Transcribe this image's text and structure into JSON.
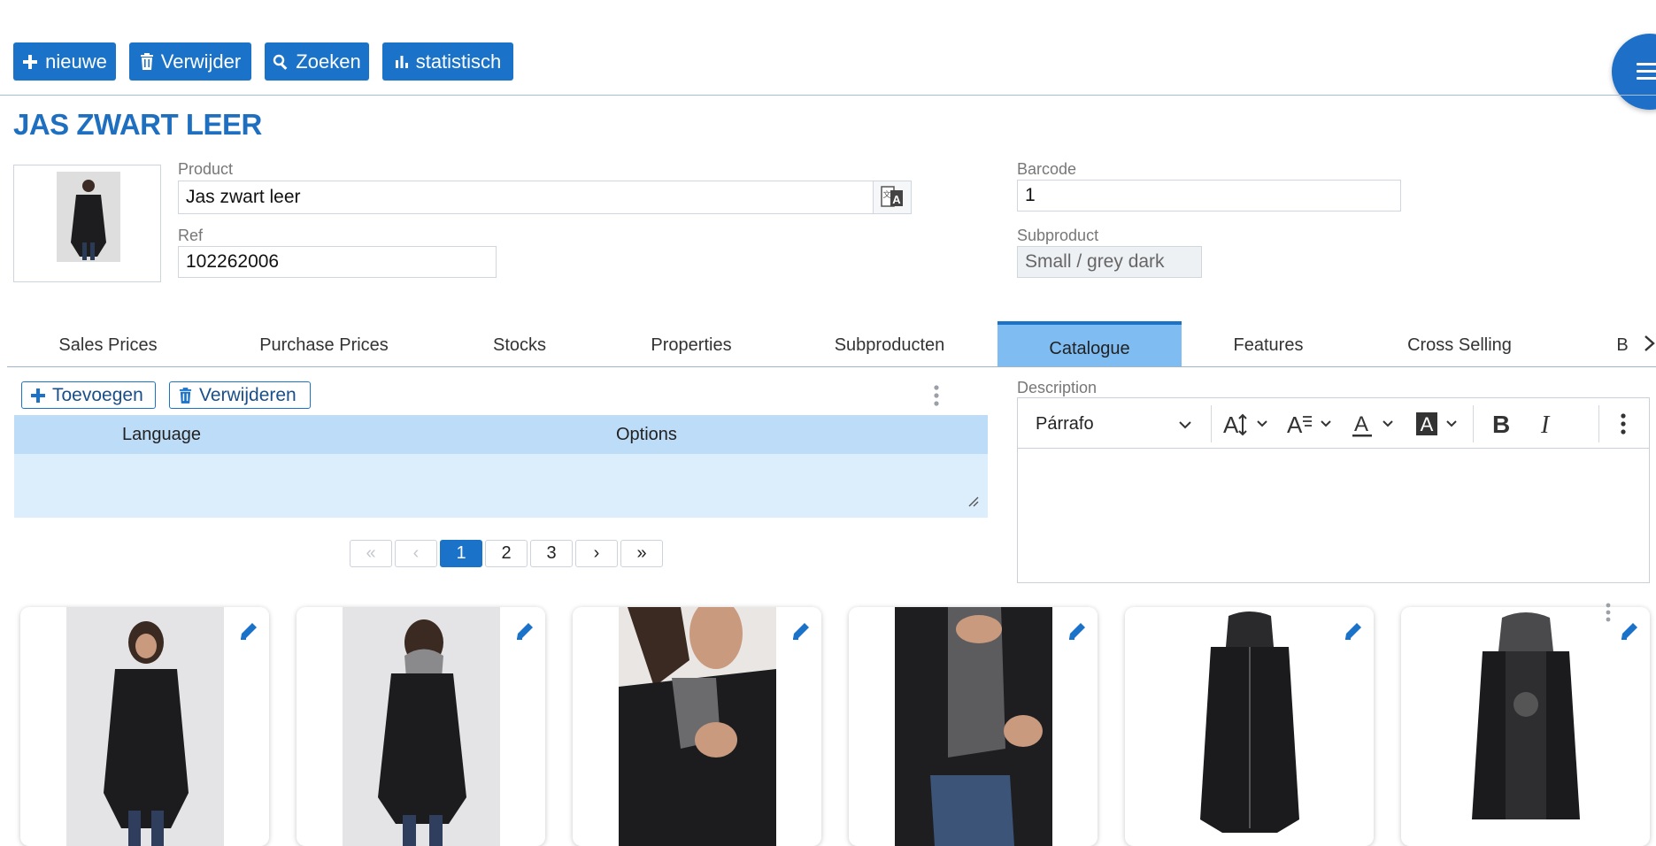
{
  "toolbar": {
    "new_label": "nieuwe",
    "delete_label": "Verwijder",
    "search_label": "Zoeken",
    "stats_label": "statistisch"
  },
  "page": {
    "title": "JAS ZWART LEER"
  },
  "form": {
    "product_label": "Product",
    "product_value": "Jas zwart leer",
    "ref_label": "Ref",
    "ref_value": "102262006",
    "barcode_label": "Barcode",
    "barcode_value": "1",
    "subproduct_label": "Subproduct",
    "subproduct_value": "Small / grey dark"
  },
  "tabs": [
    {
      "label": "Sales Prices"
    },
    {
      "label": "Purchase Prices"
    },
    {
      "label": "Stocks"
    },
    {
      "label": "Properties"
    },
    {
      "label": "Subproducten"
    },
    {
      "label": "Catalogue"
    },
    {
      "label": "Features"
    },
    {
      "label": "Cross Selling"
    },
    {
      "label": "B"
    }
  ],
  "active_tab": "Catalogue",
  "grid": {
    "add_label": "Toevoegen",
    "remove_label": "Verwijderen",
    "columns": [
      "Language",
      "Options"
    ]
  },
  "pagination": {
    "first": "«",
    "prev": "‹",
    "pages": [
      "1",
      "2",
      "3"
    ],
    "next": "›",
    "last": "»",
    "current": 1
  },
  "description": {
    "label": "Description",
    "paragraph_style": "Párrafo"
  },
  "images": [
    {
      "icon": "pencil-icon"
    },
    {
      "icon": "pencil-icon"
    },
    {
      "icon": "pencil-icon"
    },
    {
      "icon": "pencil-icon"
    },
    {
      "icon": "pencil-icon"
    },
    {
      "icon": "pencil-icon"
    }
  ],
  "colors": {
    "primary": "#1a73c8",
    "title": "#1f6fc1",
    "tab_active": "#7ebcf2",
    "grid_header": "#bcdcf8",
    "grid_body": "#dcedfc"
  }
}
